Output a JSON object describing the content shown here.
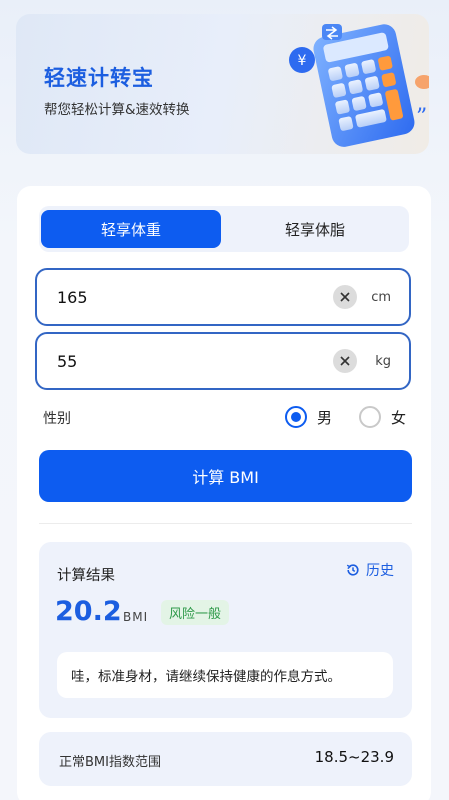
{
  "banner": {
    "title": "轻速计转宝",
    "subtitle": "帮您轻松计算&速效转换",
    "illustration": "calculator-illustration",
    "yen_symbol": "¥"
  },
  "tabs": [
    {
      "label": "轻享体重",
      "active": true
    },
    {
      "label": "轻享体脂",
      "active": false
    }
  ],
  "height_field": {
    "value": "165",
    "unit": "cm",
    "clear_icon": "close-icon"
  },
  "weight_field": {
    "value": "55",
    "unit": "kg",
    "clear_icon": "close-icon"
  },
  "gender": {
    "label": "性别",
    "options": [
      {
        "label": "男",
        "checked": true
      },
      {
        "label": "女",
        "checked": false
      }
    ]
  },
  "calculate_button": {
    "label": "计算 BMI"
  },
  "result": {
    "title": "计算结果",
    "history_label": "历史",
    "history_icon": "history-icon",
    "bmi_value": "20.2",
    "bmi_unit": "BMI",
    "risk_badge": "风险一般",
    "tip": "哇，标准身材，请继续保持健康的作息方式。"
  },
  "normal_range": {
    "label": "正常BMI指数范围",
    "value": "18.5~23.9"
  },
  "colors": {
    "accent": "#0d5cf0",
    "title_blue": "#1c5ee0",
    "badge_green": "#2f9a4a",
    "badge_bg": "#e3f4e6",
    "panel_bg": "#eef2fb"
  }
}
